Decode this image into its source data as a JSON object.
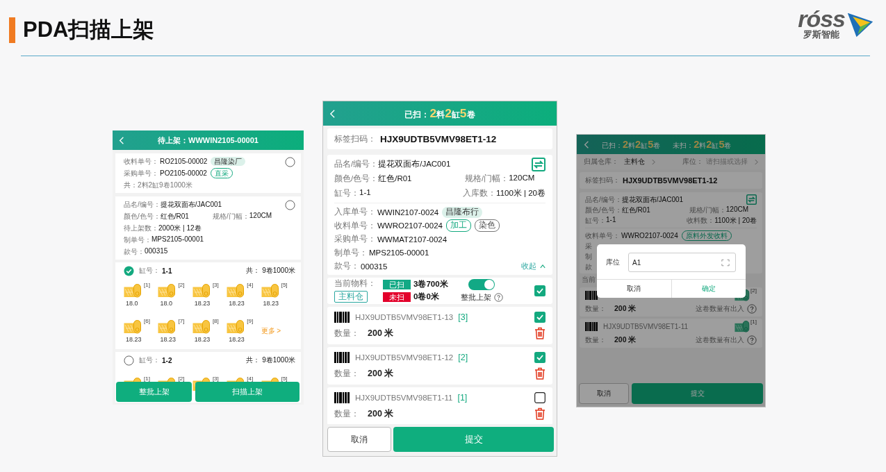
{
  "slide": {
    "title": "PDA扫描上架",
    "logo_wordmark": "róss",
    "logo_tagline": "罗斯智能"
  },
  "list_screen": {
    "title": "待上架：WWWIN2105-00001",
    "order_card": {
      "selected": false,
      "rows": [
        {
          "label": "收料单号：",
          "value": "RO2105-00002",
          "tag": {
            "text": "昌隆染厂",
            "kind": "filled"
          }
        },
        {
          "label": "采购单号：",
          "value": "PO2105-00002",
          "tag": {
            "text": "直采",
            "kind": "outline"
          }
        }
      ],
      "total": "共：2料2缸9卷1000米"
    },
    "item_card": {
      "selected": false,
      "rows": [
        [
          {
            "label": "品名/编号：",
            "value": "提花双面布/JAC001"
          }
        ],
        [
          {
            "label": "颜色/色号：",
            "value": "红色/R01"
          },
          {
            "label": "规格/门幅：",
            "value": "120CM"
          }
        ],
        [
          {
            "label": "待上架数：",
            "value": "2000米 | 12卷"
          }
        ],
        [
          {
            "label": "制单号：",
            "value": "MPS2105-00001"
          }
        ],
        [
          {
            "label": "款号：",
            "value": "000315"
          }
        ]
      ]
    },
    "batches": [
      {
        "selected": true,
        "label": "缸号：",
        "value": "1-1",
        "total_label": "共：",
        "total": "9卷1000米",
        "more": "更多 >",
        "rolls": [
          {
            "index": "[1]",
            "length": "18.0"
          },
          {
            "index": "[2]",
            "length": "18.0"
          },
          {
            "index": "[3]",
            "length": "18.23"
          },
          {
            "index": "[4]",
            "length": "18.23"
          },
          {
            "index": "[5]",
            "length": "18.23"
          },
          {
            "index": "[6]",
            "length": "18.23"
          },
          {
            "index": "[7]",
            "length": "18.23"
          },
          {
            "index": "[8]",
            "length": "18.23"
          },
          {
            "index": "[9]",
            "length": "18.23"
          }
        ]
      },
      {
        "selected": false,
        "label": "缸号：",
        "value": "1-2",
        "total_label": "共：",
        "total": "9卷1000米",
        "rolls": [
          {
            "index": "[1]"
          },
          {
            "index": "[2]"
          },
          {
            "index": "[3]"
          },
          {
            "index": "[4]"
          },
          {
            "index": "[5]"
          }
        ]
      }
    ],
    "buttons": [
      "整批上架",
      "扫描上架"
    ]
  },
  "scan_screen": {
    "count_label": "已扫：",
    "counts": [
      {
        "number": "2",
        "unit": "料"
      },
      {
        "number": "2",
        "unit": "缸"
      },
      {
        "number": "5",
        "unit": "卷"
      }
    ],
    "scan": {
      "label": "标签扫码：",
      "value": "HJX9UDTB5VMV98ET1-12"
    },
    "product_rows": [
      [
        {
          "label": "品名/编号：",
          "value": "提花双面布/JAC001"
        }
      ],
      [
        {
          "label": "颜色/色号：",
          "value": "红色/R01"
        },
        {
          "label": "规格/门幅：",
          "value": "120CM"
        }
      ],
      [
        {
          "label": "缸号：",
          "value": "1-1"
        },
        {
          "label": "入库数：",
          "value": "1100米 | 20卷"
        }
      ]
    ],
    "order_rows": [
      {
        "label": "入库单号：",
        "value": "WWIN2107-0024",
        "tags": [
          {
            "text": "昌隆布行",
            "kind": "filled"
          }
        ]
      },
      {
        "label": "收料单号：",
        "value": "WWRO2107-0024",
        "tags": [
          {
            "text": "加工",
            "kind": "outline"
          },
          {
            "text": "染色",
            "kind": "grey"
          }
        ]
      },
      {
        "label": "采购单号：",
        "value": "WWMAT2107-0024"
      },
      {
        "label": "制单号：",
        "value": "MPS2105-00001"
      },
      {
        "label": "款号：",
        "value": "000315"
      }
    ],
    "collapse": "收起",
    "summary": {
      "label": "当前物料：",
      "warehouse": "主料仓",
      "scanned": {
        "badge": "已扫",
        "value": "3卷700米"
      },
      "unscanned": {
        "badge": "未扫",
        "value": "0卷0米"
      },
      "toggle_on": true,
      "toggle_label": "整批上架",
      "checked": true
    },
    "rolls": [
      {
        "code": "HJX9UDTB5VMV98ET1-13",
        "index": "[3]",
        "qty_label": "数量：",
        "qty": "200 米",
        "checked": true
      },
      {
        "code": "HJX9UDTB5VMV98ET1-12",
        "index": "[2]",
        "qty_label": "数量：",
        "qty": "200 米",
        "checked": true
      },
      {
        "code": "HJX9UDTB5VMV98ET1-11",
        "index": "[1]",
        "qty_label": "数量：",
        "qty": "200 米",
        "checked": false
      }
    ],
    "buttons": [
      "取消",
      "提交"
    ]
  },
  "dialog_screen": {
    "count_groups": [
      {
        "label": "已扫：",
        "counts": [
          {
            "number": "2",
            "unit": "料"
          },
          {
            "number": "2",
            "unit": "缸"
          },
          {
            "number": "5",
            "unit": "卷"
          }
        ]
      },
      {
        "label": "未扫：",
        "counts": [
          {
            "number": "2",
            "unit": "料"
          },
          {
            "number": "2",
            "unit": "缸"
          },
          {
            "number": "5",
            "unit": "卷"
          }
        ]
      }
    ],
    "location_row": [
      {
        "label": "归属仓库：",
        "value": "主料仓"
      },
      {
        "label": "库位：",
        "placeholder": "请扫描或选择"
      }
    ],
    "scan": {
      "label": "标签扫码：",
      "value": "HJX9UDTB5VMV98ET1-12"
    },
    "product_rows": [
      [
        {
          "label": "品名/编号：",
          "value": "提花双面布/JAC001"
        }
      ],
      [
        {
          "label": "颜色/色号：",
          "value": "红色/R01"
        },
        {
          "label": "规格/门幅：",
          "value": "120CM"
        }
      ],
      [
        {
          "label": "缸号：",
          "value": "1-1"
        },
        {
          "label": "收料数：",
          "value": "1100米 | 20卷"
        }
      ]
    ],
    "order_rows": [
      {
        "label": "收料单号：",
        "value": "WWRO2107-0024",
        "tags": [
          {
            "text": "原料外发收料",
            "kind": "outline"
          }
        ]
      },
      {
        "label": "采"
      },
      {
        "label": "制"
      },
      {
        "label": "款"
      }
    ],
    "current_label": "当前",
    "rolls": [
      {
        "index": "[2]",
        "qty_label": "数量：",
        "qty": "200 米",
        "note": "这卷数量有出入"
      },
      {
        "code": "HJX9UDTB5VMV98ET1-11",
        "index": "[1]",
        "qty_label": "数量：",
        "qty": "200 米",
        "note": "这卷数量有出入"
      }
    ],
    "dialog": {
      "label": "库位",
      "value": "A1",
      "buttons": [
        {
          "text": "取消",
          "kind": "cancel"
        },
        {
          "text": "确定",
          "kind": "confirm"
        }
      ]
    },
    "buttons": [
      "取消",
      "提交"
    ]
  }
}
